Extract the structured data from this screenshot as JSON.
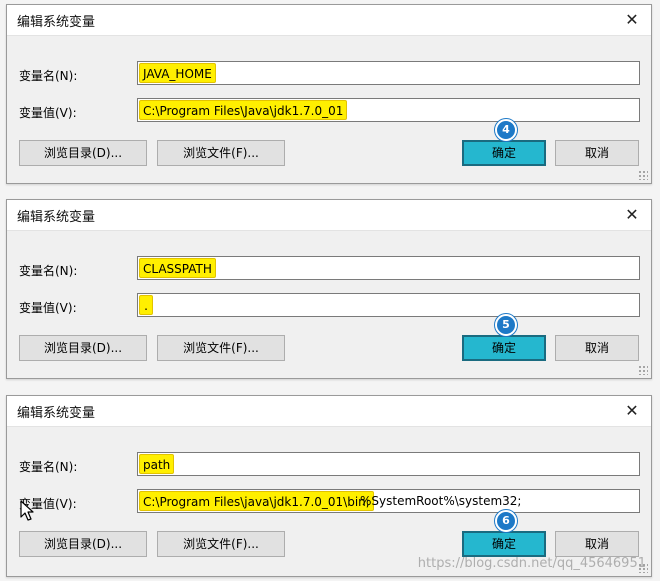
{
  "dialogs": [
    {
      "title": "编辑系统变量",
      "name_label": "变量名(N):",
      "value_label": "变量值(V):",
      "name_value": "JAVA_HOME",
      "value_highlight": "C:\\Program Files\\Java\\jdk1.7.0_01",
      "value_rest": "",
      "browse_dir_label": "浏览目录(D)...",
      "browse_file_label": "浏览文件(F)...",
      "ok_label": "确定",
      "cancel_label": "取消",
      "step_badge": "4"
    },
    {
      "title": "编辑系统变量",
      "name_label": "变量名(N):",
      "value_label": "变量值(V):",
      "name_value": "CLASSPATH",
      "value_highlight": ".",
      "value_rest": "",
      "browse_dir_label": "浏览目录(D)...",
      "browse_file_label": "浏览文件(F)...",
      "ok_label": "确定",
      "cancel_label": "取消",
      "step_badge": "5"
    },
    {
      "title": "编辑系统变量",
      "name_label": "变量名(N):",
      "value_label": "变量值(V):",
      "name_value": "path",
      "value_highlight": "C:\\Program Files\\java\\jdk1.7.0_01\\bin;",
      "value_rest": "%SystemRoot%\\system32;",
      "browse_dir_label": "浏览目录(D)...",
      "browse_file_label": "浏览文件(F)...",
      "ok_label": "确定",
      "cancel_label": "取消",
      "step_badge": "6"
    }
  ],
  "icons": {
    "close": "close-icon",
    "cursor": "mouse-pointer-icon",
    "grip": "resize-grip-icon"
  },
  "colors": {
    "highlight": "#ffef00",
    "ok_button": "#25b7cf",
    "badge": "#1d79c7"
  },
  "watermark": "https://blog.csdn.net/qq_45646951"
}
